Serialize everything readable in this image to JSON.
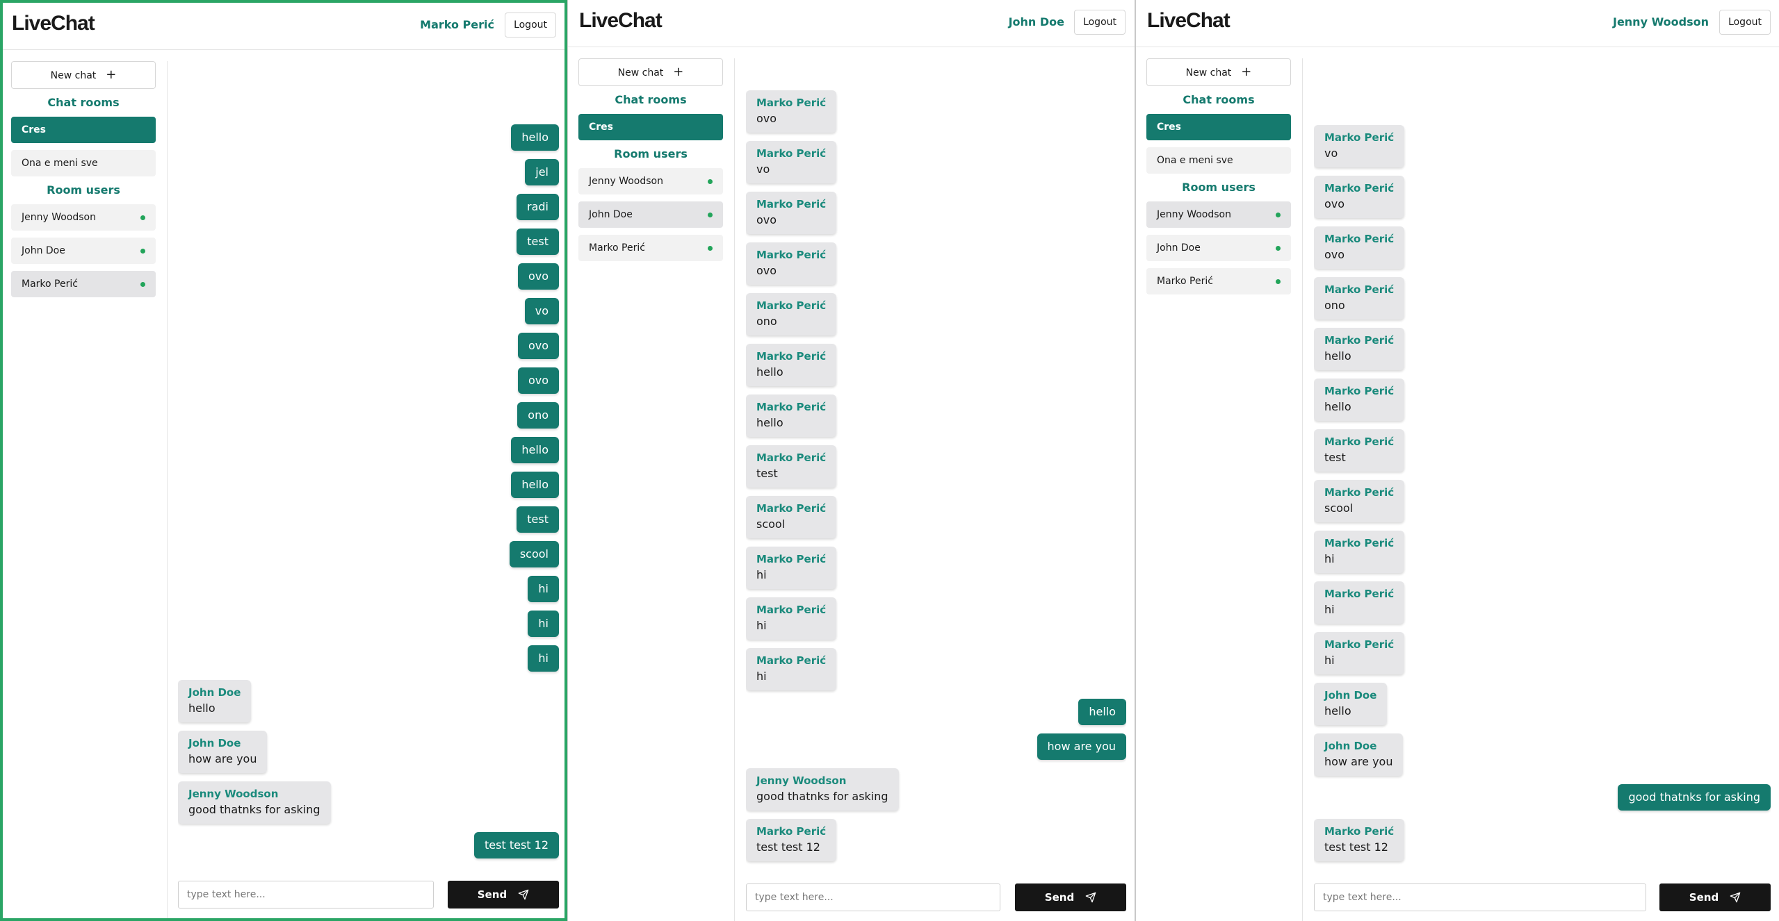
{
  "app": {
    "logo": "LiveChat",
    "logout_label": "Logout",
    "new_chat_label": "New chat",
    "new_chat_icon": "+",
    "chat_rooms_title": "Chat rooms",
    "room_users_title": "Room users",
    "input_placeholder": "type text here...",
    "send_label": "Send",
    "accent_color": "#157a6e",
    "online_color": "#22a45a"
  },
  "panels": [
    {
      "username": "Marko Perić",
      "rooms": [
        "Cres",
        "Ona e meni sve"
      ],
      "active_room": "Cres",
      "users": [
        "Jenny Woodson",
        "John Doe",
        "Marko Perić"
      ],
      "messages": [
        {
          "dir": "out",
          "text": "hello"
        },
        {
          "dir": "out",
          "text": "jel"
        },
        {
          "dir": "out",
          "text": "radi"
        },
        {
          "dir": "out",
          "text": "test"
        },
        {
          "dir": "out",
          "text": "ovo"
        },
        {
          "dir": "out",
          "text": "vo"
        },
        {
          "dir": "out",
          "text": "ovo"
        },
        {
          "dir": "out",
          "text": "ovo"
        },
        {
          "dir": "out",
          "text": "ono"
        },
        {
          "dir": "out",
          "text": "hello"
        },
        {
          "dir": "out",
          "text": "hello"
        },
        {
          "dir": "out",
          "text": "test"
        },
        {
          "dir": "out",
          "text": "scool"
        },
        {
          "dir": "out",
          "text": "hi"
        },
        {
          "dir": "out",
          "text": "hi"
        },
        {
          "dir": "out",
          "text": "hi"
        },
        {
          "dir": "in",
          "sender": "John Doe",
          "text": "hello"
        },
        {
          "dir": "in",
          "sender": "John Doe",
          "text": "how are you"
        },
        {
          "dir": "in",
          "sender": "Jenny Woodson",
          "text": "good thatnks for asking"
        },
        {
          "dir": "out",
          "text": "test test 12"
        }
      ]
    },
    {
      "username": "John Doe",
      "rooms": [
        "Cres"
      ],
      "active_room": "Cres",
      "users": [
        "Jenny Woodson",
        "John Doe",
        "Marko Perić"
      ],
      "messages": [
        {
          "dir": "in",
          "sender": "Marko Perić",
          "text": "ovo"
        },
        {
          "dir": "in",
          "sender": "Marko Perić",
          "text": "vo"
        },
        {
          "dir": "in",
          "sender": "Marko Perić",
          "text": "ovo"
        },
        {
          "dir": "in",
          "sender": "Marko Perić",
          "text": "ovo"
        },
        {
          "dir": "in",
          "sender": "Marko Perić",
          "text": "ono"
        },
        {
          "dir": "in",
          "sender": "Marko Perić",
          "text": "hello"
        },
        {
          "dir": "in",
          "sender": "Marko Perić",
          "text": "hello"
        },
        {
          "dir": "in",
          "sender": "Marko Perić",
          "text": "test"
        },
        {
          "dir": "in",
          "sender": "Marko Perić",
          "text": "scool"
        },
        {
          "dir": "in",
          "sender": "Marko Perić",
          "text": "hi"
        },
        {
          "dir": "in",
          "sender": "Marko Perić",
          "text": "hi"
        },
        {
          "dir": "in",
          "sender": "Marko Perić",
          "text": "hi"
        },
        {
          "dir": "out",
          "text": "hello"
        },
        {
          "dir": "out",
          "text": "how are you"
        },
        {
          "dir": "in",
          "sender": "Jenny Woodson",
          "text": "good thatnks for asking"
        },
        {
          "dir": "in",
          "sender": "Marko Perić",
          "text": "test test 12"
        }
      ]
    },
    {
      "username": "Jenny Woodson",
      "rooms": [
        "Cres",
        "Ona e meni sve"
      ],
      "active_room": "Cres",
      "users": [
        "Jenny Woodson",
        "John Doe",
        "Marko Perić"
      ],
      "messages": [
        {
          "dir": "in",
          "sender": "Marko Perić",
          "text": "vo"
        },
        {
          "dir": "in",
          "sender": "Marko Perić",
          "text": "ovo"
        },
        {
          "dir": "in",
          "sender": "Marko Perić",
          "text": "ovo"
        },
        {
          "dir": "in",
          "sender": "Marko Perić",
          "text": "ono"
        },
        {
          "dir": "in",
          "sender": "Marko Perić",
          "text": "hello"
        },
        {
          "dir": "in",
          "sender": "Marko Perić",
          "text": "hello"
        },
        {
          "dir": "in",
          "sender": "Marko Perić",
          "text": "test"
        },
        {
          "dir": "in",
          "sender": "Marko Perić",
          "text": "scool"
        },
        {
          "dir": "in",
          "sender": "Marko Perić",
          "text": "hi"
        },
        {
          "dir": "in",
          "sender": "Marko Perić",
          "text": "hi"
        },
        {
          "dir": "in",
          "sender": "Marko Perić",
          "text": "hi"
        },
        {
          "dir": "in",
          "sender": "John Doe",
          "text": "hello"
        },
        {
          "dir": "in",
          "sender": "John Doe",
          "text": "how are you"
        },
        {
          "dir": "out",
          "text": "good thatnks for asking"
        },
        {
          "dir": "in",
          "sender": "Marko Perić",
          "text": "test test 12"
        }
      ]
    }
  ]
}
